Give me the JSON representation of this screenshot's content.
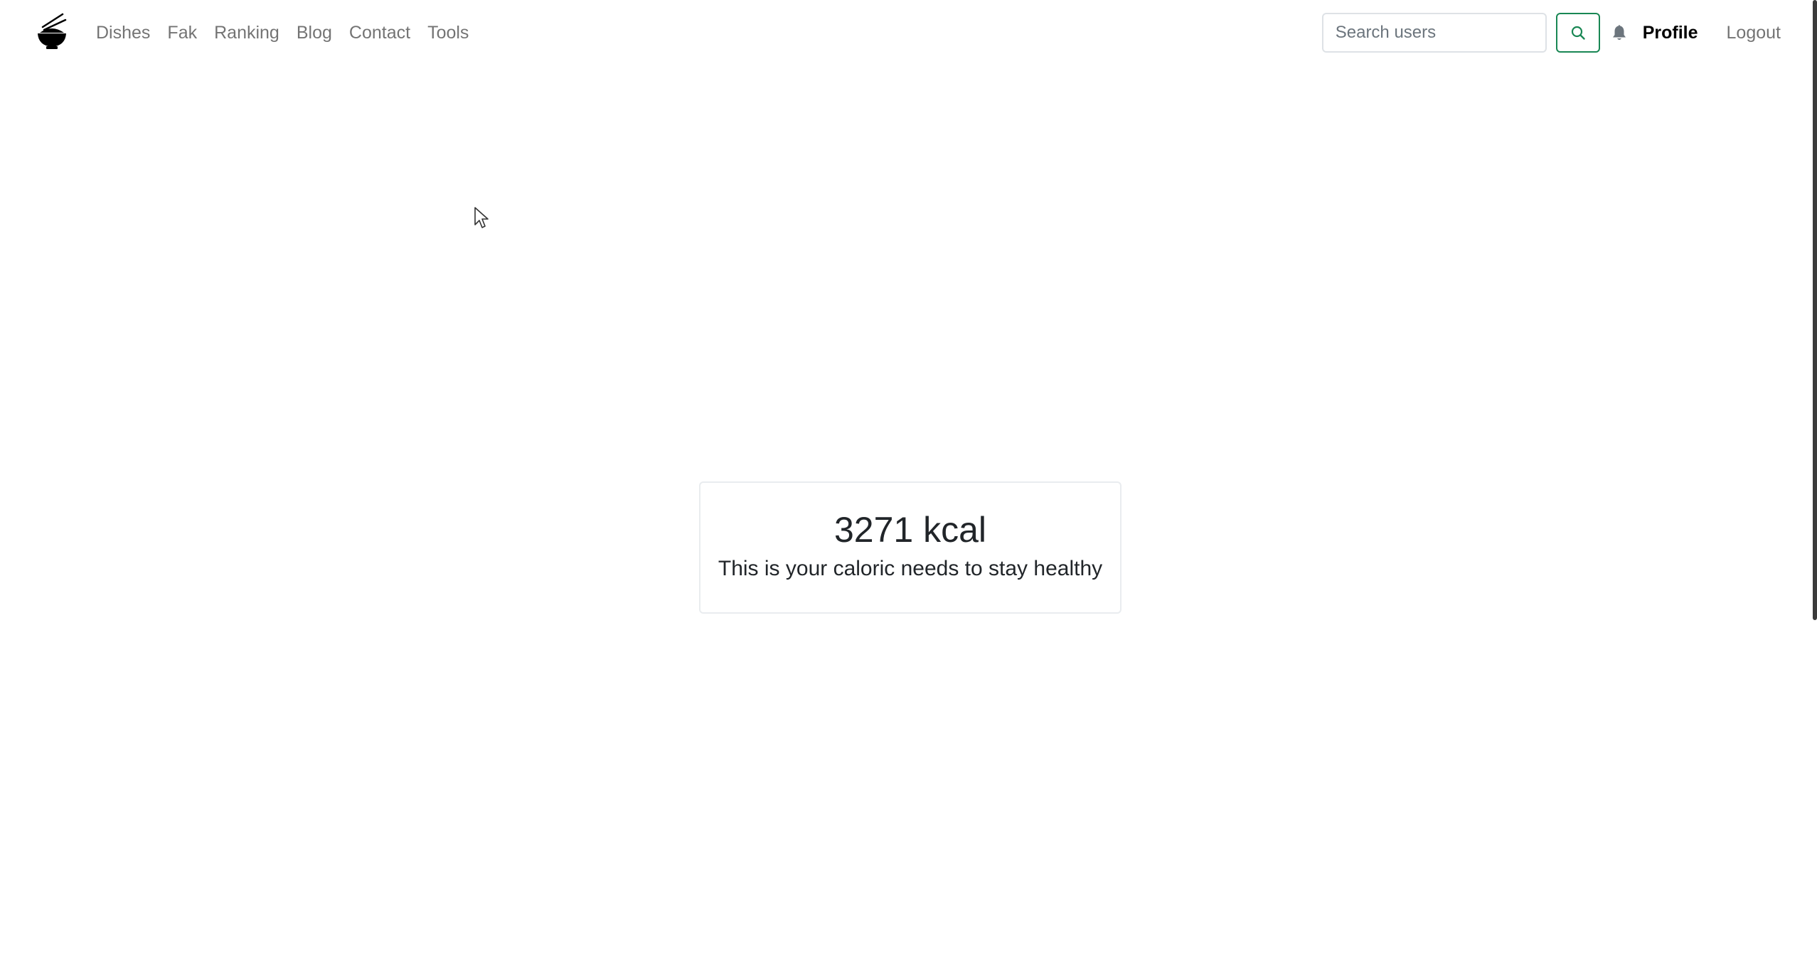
{
  "navbar": {
    "brand_icon": "rice-bowl-chopsticks-icon",
    "links": [
      {
        "label": "Dishes"
      },
      {
        "label": "Fak"
      },
      {
        "label": "Ranking"
      },
      {
        "label": "Blog"
      },
      {
        "label": "Contact"
      },
      {
        "label": "Tools"
      }
    ],
    "search": {
      "placeholder": "Search users",
      "value": "",
      "button_icon": "search-icon"
    },
    "notification_icon": "bell-icon",
    "profile_label": "Profile",
    "logout_label": "Logout"
  },
  "result": {
    "kcal_text": "3271 kcal",
    "caption": "This is your caloric needs to stay healthy"
  },
  "colors": {
    "accent_green": "#198754",
    "text": "#212529",
    "muted_link": "#7f7f7f"
  }
}
